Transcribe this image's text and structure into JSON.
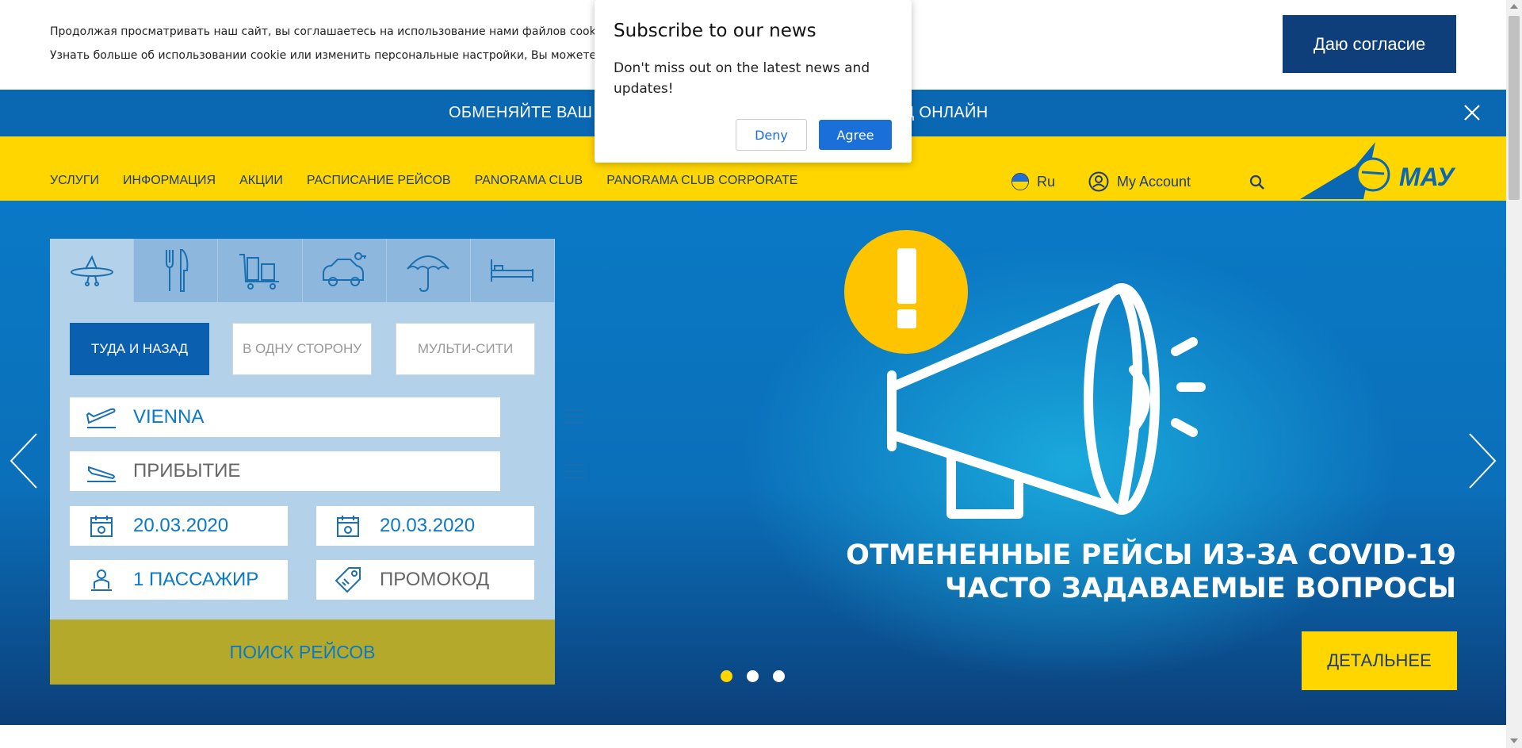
{
  "cookie": {
    "line1": "Продолжая просматривать наш сайт, вы соглашаетесь на использование нами файлов cookie",
    "line2": "Узнать больше об использовании cookie или изменить персональные настройки, Вы можете",
    "accept_label": "Даю согласие"
  },
  "promo": {
    "text": "ОБМЕНЯЙТЕ ВАШ Б                                              ПРОМОКОД ОНЛАЙН"
  },
  "nav": {
    "items": [
      "УСЛУГИ",
      "ИНФОРМАЦИЯ",
      "АКЦИИ",
      "РАСПИСАНИЕ РЕЙСОВ",
      "PANORAMA CLUB",
      "PANORAMA CLUB CORPORATE"
    ],
    "lang": "Ru",
    "account": "My Account",
    "logo_text": "МАУ"
  },
  "booking": {
    "trip_types": [
      "ТУДА И НАЗАД",
      "В ОДНУ СТОРОНУ",
      "МУЛЬТИ-СИТИ"
    ],
    "from_value": "VIENNA",
    "to_placeholder": "ПРИБЫТИЕ",
    "date_out": "20.03.2020",
    "date_back": "20.03.2020",
    "passengers": "1 ПАССАЖИР",
    "promo_placeholder": "ПРОМОКОД",
    "search_label": "ПОИСК РЕЙСОВ",
    "tab_icons": [
      "plane-icon",
      "cutlery-icon",
      "luggage-icon",
      "car-icon",
      "umbrella-icon",
      "bed-icon"
    ]
  },
  "hero": {
    "title_line1": "ОТМЕНЕННЫЕ РЕЙСЫ ИЗ-ЗА COVID-19",
    "title_line2": "ЧАСТО ЗАДАВАЕМЫЕ ВОПРОСЫ",
    "more_label": "ДЕТАЛЬНЕЕ",
    "slides": 3,
    "active_slide": 1
  },
  "popup": {
    "title": "Subscribe to our news",
    "body": "Don't miss out on the latest news and updates!",
    "deny": "Deny",
    "agree": "Agree"
  },
  "colors": {
    "brand_blue": "#0a67b2",
    "brand_yellow": "#ffd600",
    "navy": "#1f3d74",
    "olive_button": "#b4a92a"
  }
}
